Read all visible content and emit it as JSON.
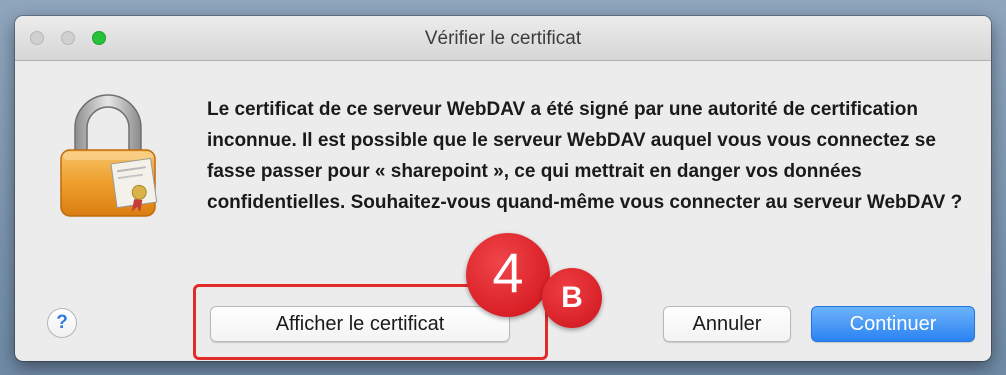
{
  "window": {
    "title": "Vérifier le certificat"
  },
  "dialog": {
    "message": "Le certificat de ce serveur WebDAV a été signé par une autorité de certification inconnue. Il est possible que le serveur WebDAV auquel vous vous connectez se fasse passer pour « sharepoint », ce qui mettrait en danger vos données confidentielles. Souhaitez-vous quand-même vous connecter au serveur WebDAV ?",
    "icon": "lock-certificate-icon"
  },
  "buttons": {
    "help_label": "?",
    "show_certificate_label": "Afficher le certificat",
    "cancel_label": "Annuler",
    "continue_label": "Continuer"
  },
  "annotation": {
    "step_number": "4",
    "step_letter": "B",
    "color": "#e22b2b"
  },
  "colors": {
    "accent_button": "#2b82f2",
    "zoom_light": "#27c13a"
  }
}
